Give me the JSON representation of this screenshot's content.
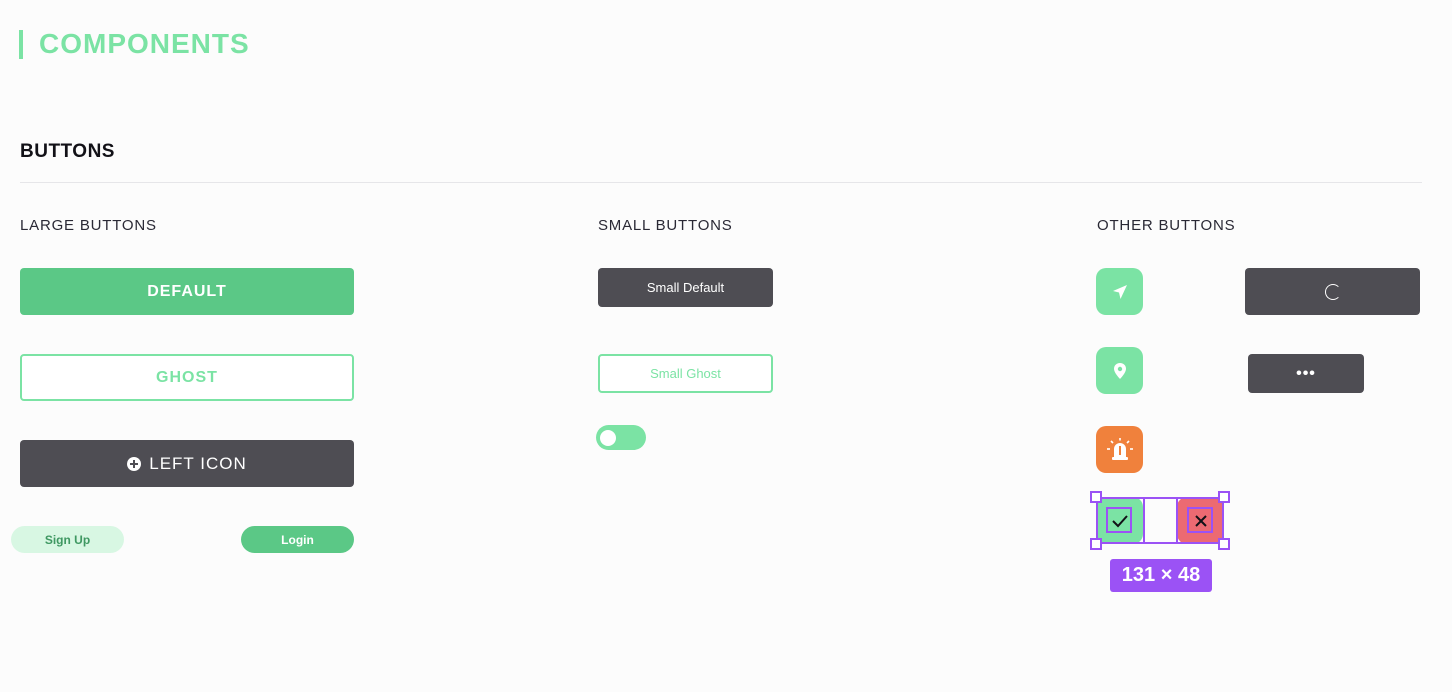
{
  "page": {
    "title": "COMPONENTS"
  },
  "section": {
    "title": "BUTTONS"
  },
  "columns": {
    "large": "LARGE BUTTONS",
    "small": "SMALL BUTTONS",
    "other": "OTHER BUTTONS"
  },
  "large_buttons": {
    "default_label": "DEFAULT",
    "ghost_label": "GHOST",
    "left_icon_label": "LEFT ICON",
    "left_icon_name": "plus-circle-icon",
    "signup_label": "Sign Up",
    "login_label": "Login"
  },
  "small_buttons": {
    "default_label": "Small Default",
    "ghost_label": "Small Ghost",
    "toggle_state": "off"
  },
  "other_buttons": {
    "icons": [
      "navigation-arrow-icon",
      "map-pin-icon",
      "siren-alarm-icon",
      "checkmark-icon",
      "close-x-icon",
      "loading-spinner-icon",
      "more-dots-icon"
    ],
    "more_label": "•••"
  },
  "selection": {
    "dimensions": "131 × 48"
  },
  "colors": {
    "accent_green": "#7be3a4",
    "primary_green": "#5bc886",
    "dark": "#4e4d53",
    "orange": "#f0813c",
    "red": "#ec6a72",
    "selection_purple": "#9b52f5"
  }
}
